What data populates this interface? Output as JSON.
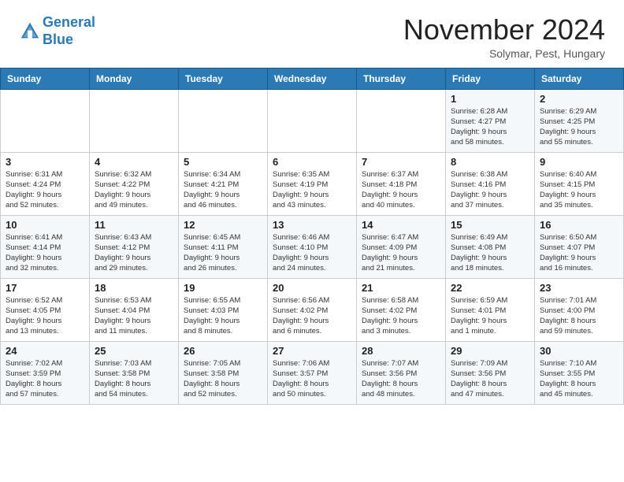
{
  "header": {
    "logo_line1": "General",
    "logo_line2": "Blue",
    "month_title": "November 2024",
    "location": "Solymar, Pest, Hungary"
  },
  "weekdays": [
    "Sunday",
    "Monday",
    "Tuesday",
    "Wednesday",
    "Thursday",
    "Friday",
    "Saturday"
  ],
  "weeks": [
    [
      {
        "day": "",
        "info": ""
      },
      {
        "day": "",
        "info": ""
      },
      {
        "day": "",
        "info": ""
      },
      {
        "day": "",
        "info": ""
      },
      {
        "day": "",
        "info": ""
      },
      {
        "day": "1",
        "info": "Sunrise: 6:28 AM\nSunset: 4:27 PM\nDaylight: 9 hours\nand 58 minutes."
      },
      {
        "day": "2",
        "info": "Sunrise: 6:29 AM\nSunset: 4:25 PM\nDaylight: 9 hours\nand 55 minutes."
      }
    ],
    [
      {
        "day": "3",
        "info": "Sunrise: 6:31 AM\nSunset: 4:24 PM\nDaylight: 9 hours\nand 52 minutes."
      },
      {
        "day": "4",
        "info": "Sunrise: 6:32 AM\nSunset: 4:22 PM\nDaylight: 9 hours\nand 49 minutes."
      },
      {
        "day": "5",
        "info": "Sunrise: 6:34 AM\nSunset: 4:21 PM\nDaylight: 9 hours\nand 46 minutes."
      },
      {
        "day": "6",
        "info": "Sunrise: 6:35 AM\nSunset: 4:19 PM\nDaylight: 9 hours\nand 43 minutes."
      },
      {
        "day": "7",
        "info": "Sunrise: 6:37 AM\nSunset: 4:18 PM\nDaylight: 9 hours\nand 40 minutes."
      },
      {
        "day": "8",
        "info": "Sunrise: 6:38 AM\nSunset: 4:16 PM\nDaylight: 9 hours\nand 37 minutes."
      },
      {
        "day": "9",
        "info": "Sunrise: 6:40 AM\nSunset: 4:15 PM\nDaylight: 9 hours\nand 35 minutes."
      }
    ],
    [
      {
        "day": "10",
        "info": "Sunrise: 6:41 AM\nSunset: 4:14 PM\nDaylight: 9 hours\nand 32 minutes."
      },
      {
        "day": "11",
        "info": "Sunrise: 6:43 AM\nSunset: 4:12 PM\nDaylight: 9 hours\nand 29 minutes."
      },
      {
        "day": "12",
        "info": "Sunrise: 6:45 AM\nSunset: 4:11 PM\nDaylight: 9 hours\nand 26 minutes."
      },
      {
        "day": "13",
        "info": "Sunrise: 6:46 AM\nSunset: 4:10 PM\nDaylight: 9 hours\nand 24 minutes."
      },
      {
        "day": "14",
        "info": "Sunrise: 6:47 AM\nSunset: 4:09 PM\nDaylight: 9 hours\nand 21 minutes."
      },
      {
        "day": "15",
        "info": "Sunrise: 6:49 AM\nSunset: 4:08 PM\nDaylight: 9 hours\nand 18 minutes."
      },
      {
        "day": "16",
        "info": "Sunrise: 6:50 AM\nSunset: 4:07 PM\nDaylight: 9 hours\nand 16 minutes."
      }
    ],
    [
      {
        "day": "17",
        "info": "Sunrise: 6:52 AM\nSunset: 4:05 PM\nDaylight: 9 hours\nand 13 minutes."
      },
      {
        "day": "18",
        "info": "Sunrise: 6:53 AM\nSunset: 4:04 PM\nDaylight: 9 hours\nand 11 minutes."
      },
      {
        "day": "19",
        "info": "Sunrise: 6:55 AM\nSunset: 4:03 PM\nDaylight: 9 hours\nand 8 minutes."
      },
      {
        "day": "20",
        "info": "Sunrise: 6:56 AM\nSunset: 4:02 PM\nDaylight: 9 hours\nand 6 minutes."
      },
      {
        "day": "21",
        "info": "Sunrise: 6:58 AM\nSunset: 4:02 PM\nDaylight: 9 hours\nand 3 minutes."
      },
      {
        "day": "22",
        "info": "Sunrise: 6:59 AM\nSunset: 4:01 PM\nDaylight: 9 hours\nand 1 minute."
      },
      {
        "day": "23",
        "info": "Sunrise: 7:01 AM\nSunset: 4:00 PM\nDaylight: 8 hours\nand 59 minutes."
      }
    ],
    [
      {
        "day": "24",
        "info": "Sunrise: 7:02 AM\nSunset: 3:59 PM\nDaylight: 8 hours\nand 57 minutes."
      },
      {
        "day": "25",
        "info": "Sunrise: 7:03 AM\nSunset: 3:58 PM\nDaylight: 8 hours\nand 54 minutes."
      },
      {
        "day": "26",
        "info": "Sunrise: 7:05 AM\nSunset: 3:58 PM\nDaylight: 8 hours\nand 52 minutes."
      },
      {
        "day": "27",
        "info": "Sunrise: 7:06 AM\nSunset: 3:57 PM\nDaylight: 8 hours\nand 50 minutes."
      },
      {
        "day": "28",
        "info": "Sunrise: 7:07 AM\nSunset: 3:56 PM\nDaylight: 8 hours\nand 48 minutes."
      },
      {
        "day": "29",
        "info": "Sunrise: 7:09 AM\nSunset: 3:56 PM\nDaylight: 8 hours\nand 47 minutes."
      },
      {
        "day": "30",
        "info": "Sunrise: 7:10 AM\nSunset: 3:55 PM\nDaylight: 8 hours\nand 45 minutes."
      }
    ]
  ]
}
